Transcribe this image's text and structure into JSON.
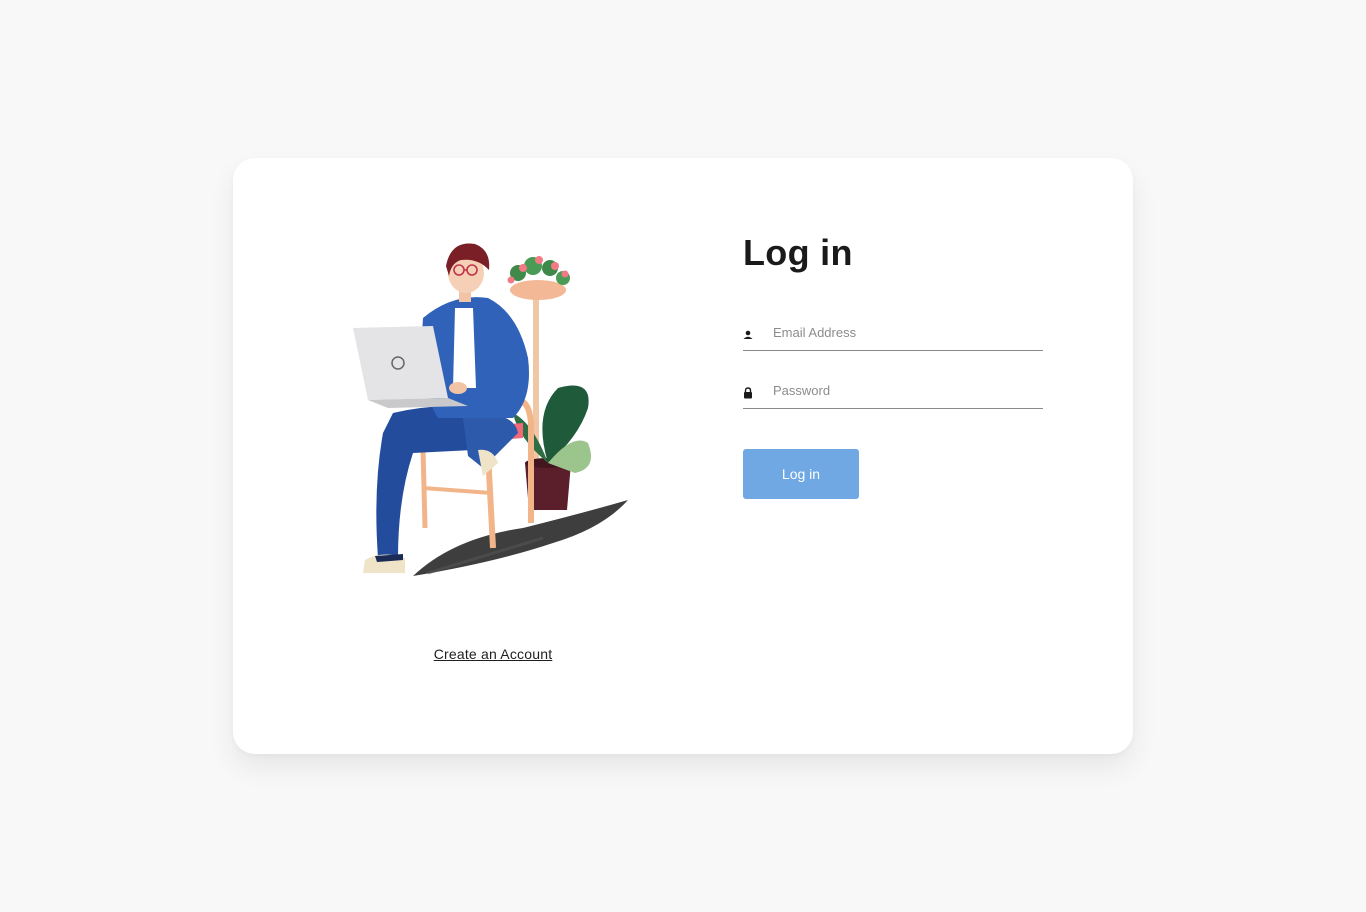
{
  "login": {
    "title": "Log in",
    "email_placeholder": "Email Address",
    "password_placeholder": "Password",
    "submit_label": "Log in",
    "create_account_label": "Create an Account"
  },
  "icons": {
    "email": "user-icon",
    "password": "lock-icon"
  },
  "colors": {
    "page_background": "#f8f8f8",
    "card_background": "#ffffff",
    "button_background": "#6fa8e3",
    "title_text": "#1a1a1a"
  }
}
